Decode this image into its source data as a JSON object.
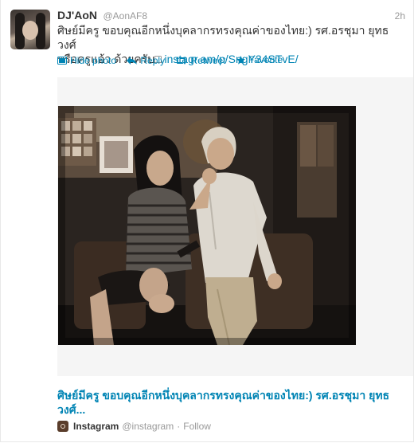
{
  "tweet": {
    "display_name": "DJ'AoN",
    "handle": "@AonAF8",
    "time": "2h",
    "text_line1": "ศิษย์มีครู ขอบคุณอีกหนึ่งบุคลากรทรงคุณค่าของไทย:) รศ.อรชุมา ยุทธวงศ์",
    "text_line2_prefix": "หรือครูแอ้ว ด้วยครับ",
    "text_link": "instagr.am/p/SngY34STvE/"
  },
  "actions": [
    {
      "label": "Hide photo",
      "icon": "photo-icon"
    },
    {
      "label": "Reply",
      "icon": "reply-icon"
    },
    {
      "label": "Retweet",
      "icon": "retweet-icon"
    },
    {
      "label": "Favorite",
      "icon": "star-icon"
    }
  ],
  "card": {
    "title": "ศิษย์มีครู ขอบคุณอีกหนึ่งบุคลากรทรงคุณค่าของไทย:) รศ.อรชุมา ยุทธวงศ์...",
    "source_name": "Instagram",
    "source_handle": "@instagram",
    "separator": "·",
    "follow_label": "Follow"
  }
}
